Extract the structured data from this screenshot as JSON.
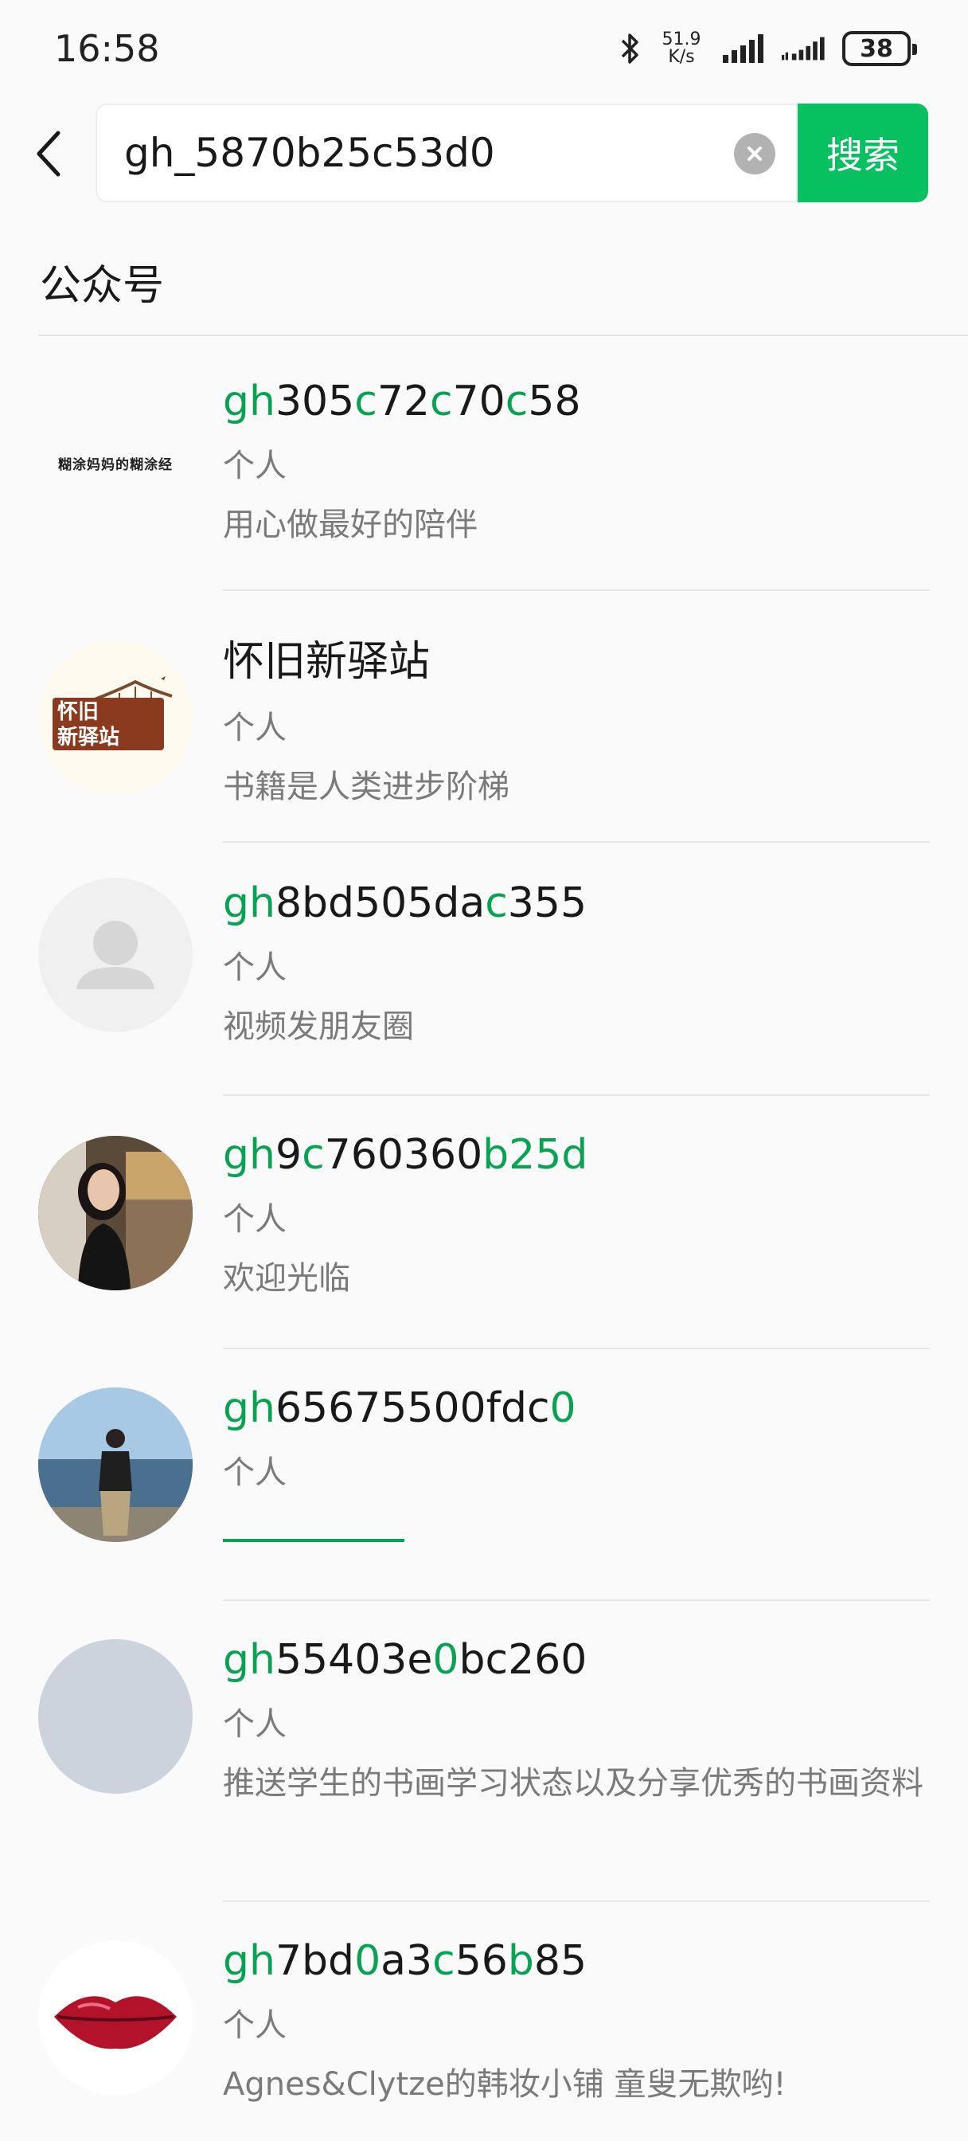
{
  "status": {
    "time": "16:58",
    "net_speed_top": "51.9",
    "net_speed_bottom": "K/s",
    "battery": "38"
  },
  "search": {
    "query": "gh_5870b25c53d0",
    "button_label": "搜索"
  },
  "section": {
    "title": "公众号"
  },
  "results": [
    {
      "name_parts": [
        [
          "gh",
          "hl"
        ],
        [
          "305",
          ""
        ],
        [
          "c",
          "hl"
        ],
        [
          "72",
          ""
        ],
        [
          "c",
          "hl"
        ],
        [
          "70",
          ""
        ],
        [
          "c",
          "hl"
        ],
        [
          "58",
          ""
        ]
      ],
      "type": "个人",
      "desc": "用心做最好的陪伴",
      "avatar_text": "糊涂妈妈的糊涂经"
    },
    {
      "name_parts": [
        [
          "怀旧新驿站",
          ""
        ]
      ],
      "type": "个人",
      "desc": "书籍是人类进步阶梯",
      "avatar_text_1": "怀旧",
      "avatar_text_2": "新驿站"
    },
    {
      "name_parts": [
        [
          "gh",
          "hl"
        ],
        [
          "8bd505da",
          ""
        ],
        [
          "c",
          "hl"
        ],
        [
          "355",
          ""
        ]
      ],
      "type": "个人",
      "desc": "视频发朋友圈"
    },
    {
      "name_parts": [
        [
          "gh",
          "hl"
        ],
        [
          "9",
          ""
        ],
        [
          "c",
          "hl"
        ],
        [
          "760360",
          ""
        ],
        [
          "b25d",
          "hl"
        ]
      ],
      "type": "个人",
      "desc": "欢迎光临"
    },
    {
      "name_parts": [
        [
          "gh",
          "hl"
        ],
        [
          "65675500fdc",
          ""
        ],
        [
          "0",
          "hl"
        ]
      ],
      "type": "个人",
      "desc": ""
    },
    {
      "name_parts": [
        [
          "gh",
          "hl"
        ],
        [
          "55403e",
          ""
        ],
        [
          "0",
          "hl"
        ],
        [
          "bc260",
          ""
        ]
      ],
      "type": "个人",
      "desc": "推送学生的书画学习状态以及分享优秀的书画资料"
    },
    {
      "name_parts": [
        [
          "gh",
          "hl"
        ],
        [
          "7bd",
          ""
        ],
        [
          "0",
          "hl"
        ],
        [
          "a3",
          ""
        ],
        [
          "c",
          "hl"
        ],
        [
          "56",
          ""
        ],
        [
          "b",
          "hl"
        ],
        [
          "85",
          ""
        ]
      ],
      "type": "个人",
      "desc": "Agnes&Clytze的韩妆小铺 童叟无欺哟!"
    }
  ],
  "colors": {
    "accent": "#07c160",
    "highlight": "#07a252"
  }
}
